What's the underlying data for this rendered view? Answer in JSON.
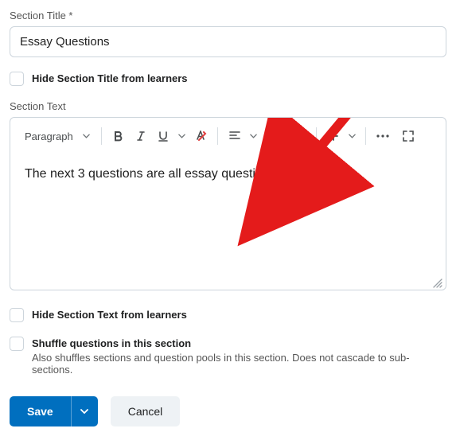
{
  "sectionTitle": {
    "label": "Section Title *",
    "value": "Essay Questions"
  },
  "hideTitle": {
    "label": "Hide Section Title from learners"
  },
  "sectionText": {
    "label": "Section Text",
    "content": "The next 3 questions are all essay questions."
  },
  "toolbar": {
    "paragraph": "Paragraph"
  },
  "hideText": {
    "label": "Hide Section Text from learners"
  },
  "shuffle": {
    "label": "Shuffle questions in this section",
    "helper": "Also shuffles sections and question pools in this section. Does not cascade to sub-sections."
  },
  "buttons": {
    "save": "Save",
    "cancel": "Cancel"
  },
  "annotation": {
    "arrow_color": "#e41b1b"
  }
}
